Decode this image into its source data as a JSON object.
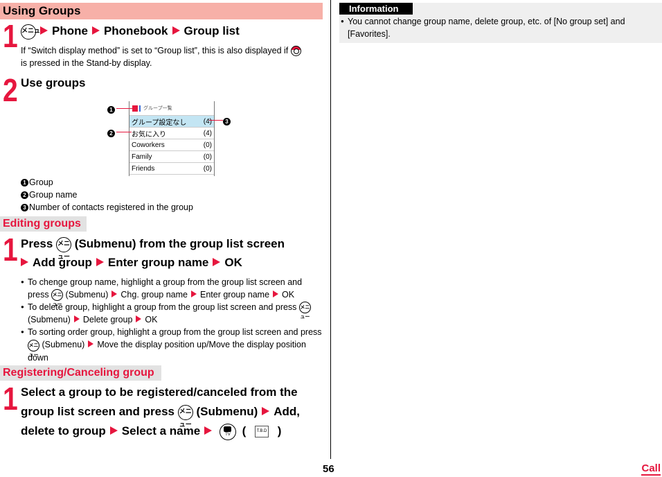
{
  "section_using": {
    "title": "Using Groups",
    "step1": {
      "num": "1",
      "key_label": "メニュー",
      "path": [
        "Phone",
        "Phonebook",
        "Group list"
      ],
      "note_before": "If “Switch display method” is set to “Group list”, this is also displayed if",
      "note_after": "is pressed in the Stand-by display."
    },
    "step2": {
      "num": "2",
      "title": "Use groups"
    },
    "screen": {
      "title": "グループ一覧",
      "rows": [
        {
          "name": "グループ設定なし",
          "count": "(4)",
          "highlighted": true
        },
        {
          "name": "お気に入り",
          "count": "(4)",
          "highlighted": false
        },
        {
          "name": "Coworkers",
          "count": "(0)",
          "highlighted": false
        },
        {
          "name": "Family",
          "count": "(0)",
          "highlighted": false
        },
        {
          "name": "Friends",
          "count": "(0)",
          "highlighted": false
        }
      ],
      "highlight_color": "#c3e5f3",
      "callouts": [
        "1",
        "2",
        "3"
      ]
    },
    "legend": [
      {
        "num": "1",
        "text": "Group"
      },
      {
        "num": "2",
        "text": "Group name"
      },
      {
        "num": "3",
        "text": "Number of contacts registered in the group"
      }
    ]
  },
  "section_editing": {
    "title": "Editing groups",
    "step1": {
      "num": "1",
      "line1_a": "Press",
      "line1_b": "(Submenu) from the group list screen",
      "path": [
        "Add group",
        "Enter group name",
        "OK"
      ]
    },
    "bullets": [
      {
        "a": "To chenge group name, highlight a group from the group list screen and press",
        "b": "(Submenu)",
        "path": [
          "Chg. group name",
          "Enter group name",
          "OK"
        ]
      },
      {
        "a": "To delete group, highlight a group from the group list screen and press",
        "b": "(Submenu)",
        "path": [
          "Delete group",
          "OK"
        ]
      },
      {
        "a": "To sorting order group, highlight a group from the group list screen and press",
        "b": "(Submenu)",
        "path": [
          "Move the display position up/Move the display position down"
        ]
      }
    ]
  },
  "section_registering": {
    "title": "Registering/Canceling group",
    "step1": {
      "num": "1",
      "line1": "Select a group to be registered/canceled from the",
      "line2_a": "group list screen and press",
      "line2_b": "(Submenu)",
      "line2_c": "Add,",
      "line3_a": "delete to group",
      "line3_b": "Select a name",
      "camera_key_label": "TV",
      "paren_open": "(",
      "tbd": "T.B.D",
      "paren_close": ")"
    }
  },
  "information": {
    "title": "Information",
    "bullets": [
      "You cannot change group name, delete group, etc. of [No group set] and [Favorites]."
    ]
  },
  "footer": {
    "page_number": "56",
    "chapter_link": "Call"
  },
  "colors": {
    "accent_red": "#e6163e",
    "section_bg": "#f7b0a8",
    "subsection_bg": "#e2e2e2"
  }
}
